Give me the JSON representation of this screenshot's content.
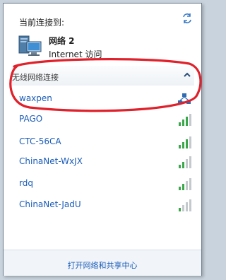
{
  "header": {
    "title": "当前连接到:",
    "refresh_icon": "refresh-arrows-icon"
  },
  "current_connection": {
    "name": "网络 2",
    "status": "Internet 访问",
    "icon": "network-computer-icon"
  },
  "wireless_section": {
    "label": "无线网络连接",
    "collapse_icon": "chevron-up-icon"
  },
  "networks": [
    {
      "name": "waxpen",
      "icon": "connecting-network-icon"
    },
    {
      "name": "PAGO",
      "icon": "signal-strength-icon"
    },
    {
      "name": "CTC-56CA",
      "icon": "signal-strength-icon"
    },
    {
      "name": "ChinaNet-WxJX",
      "icon": "signal-strength-icon"
    },
    {
      "name": "rdq",
      "icon": "signal-strength-icon"
    },
    {
      "name": "ChinaNet-JadU",
      "icon": "signal-strength-icon"
    }
  ],
  "footer": {
    "link": "打开网络和共享中心"
  },
  "colors": {
    "link": "#1a5cb8",
    "annotation": "#e0202a"
  }
}
